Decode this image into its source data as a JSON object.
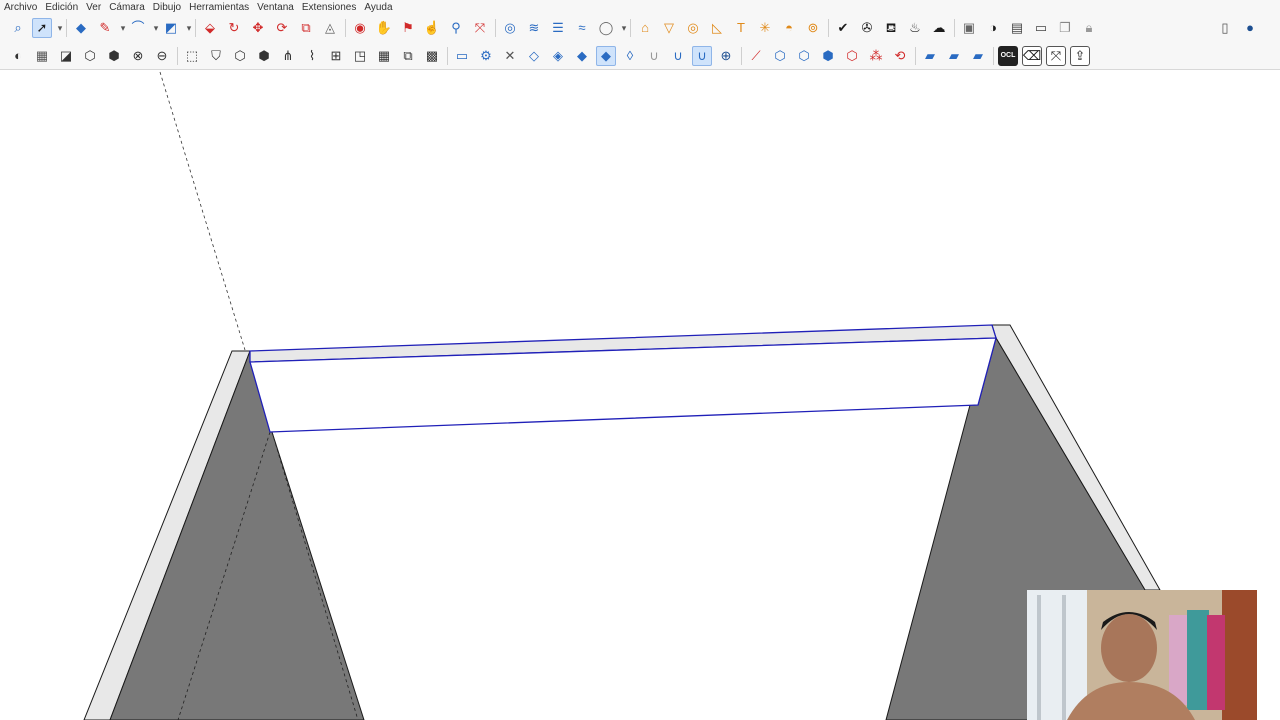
{
  "menu": {
    "items": [
      "Archivo",
      "Edición",
      "Ver",
      "Cámara",
      "Dibujo",
      "Herramientas",
      "Ventana",
      "Extensiones",
      "Ayuda"
    ]
  },
  "toolbar_top": {
    "icons": [
      {
        "name": "search-icon",
        "glyph": "⌕",
        "color": "#2a6bc2"
      },
      {
        "name": "select-tool-icon",
        "glyph": "➚",
        "color": "#1b1b1b",
        "active": true
      },
      {
        "name": "dropdown-arrow-icon",
        "glyph": "▾",
        "color": "#555"
      },
      {
        "name": "eraser-icon",
        "glyph": "◆",
        "color": "#2a6bc2"
      },
      {
        "name": "pencil-icon",
        "glyph": "✎",
        "color": "#d12a2a"
      },
      {
        "name": "dropdown-arrow-icon",
        "glyph": "▾",
        "color": "#555"
      },
      {
        "name": "arc-tool-icon",
        "glyph": "⌒",
        "color": "#2a6bc2"
      },
      {
        "name": "dropdown-arrow-icon",
        "glyph": "▾",
        "color": "#555"
      },
      {
        "name": "rectangle-tool-icon",
        "glyph": "◩",
        "color": "#2a6bc2"
      },
      {
        "name": "dropdown-arrow-icon",
        "glyph": "▾",
        "color": "#555"
      },
      {
        "name": "push-pull-icon",
        "glyph": "⬙",
        "color": "#d12a2a"
      },
      {
        "name": "follow-me-icon",
        "glyph": "↻",
        "color": "#d12a2a"
      },
      {
        "name": "move-tool-icon",
        "glyph": "✥",
        "color": "#d12a2a"
      },
      {
        "name": "rotate-tool-icon",
        "glyph": "⟳",
        "color": "#d12a2a"
      },
      {
        "name": "scale-tool-icon",
        "glyph": "⧉",
        "color": "#d12a2a"
      },
      {
        "name": "offset-tool-icon",
        "glyph": "◬",
        "color": "#666"
      },
      {
        "name": "orbit-icon",
        "glyph": "◉",
        "color": "#d12a2a"
      },
      {
        "name": "pan-icon",
        "glyph": "✋",
        "color": "#2a6bc2"
      },
      {
        "name": "walk-icon",
        "glyph": "⚑",
        "color": "#d12a2a"
      },
      {
        "name": "look-around-icon",
        "glyph": "☝",
        "color": "#d12a2a"
      },
      {
        "name": "zoom-icon",
        "glyph": "⚲",
        "color": "#2a6bc2"
      },
      {
        "name": "zoom-extents-icon",
        "glyph": "⤧",
        "color": "#d12a2a"
      },
      {
        "name": "styles-icon",
        "glyph": "◎",
        "color": "#2a6bc2"
      },
      {
        "name": "sandbox-icon",
        "glyph": "≋",
        "color": "#2a6bc2"
      },
      {
        "name": "layers-icon",
        "glyph": "☰",
        "color": "#2a6bc2"
      },
      {
        "name": "materials-icon",
        "glyph": "≈",
        "color": "#2a6bc2"
      },
      {
        "name": "user-circle-icon",
        "glyph": "◯",
        "color": "#666"
      },
      {
        "name": "dropdown-arrow-icon",
        "glyph": "▾",
        "color": "#555"
      },
      {
        "name": "warehouse-icon",
        "glyph": "⌂",
        "color": "#e08a1a"
      },
      {
        "name": "funnel-icon",
        "glyph": "▽",
        "color": "#e08a1a"
      },
      {
        "name": "ring-icon",
        "glyph": "◎",
        "color": "#e08a1a"
      },
      {
        "name": "protractor-icon",
        "glyph": "◺",
        "color": "#e08a1a"
      },
      {
        "name": "text-tool-icon",
        "glyph": "T",
        "color": "#e08a1a"
      },
      {
        "name": "axes-star-icon",
        "glyph": "✳",
        "color": "#e08a1a"
      },
      {
        "name": "dome-icon",
        "glyph": "◓",
        "color": "#e08a1a"
      },
      {
        "name": "ring-cube-icon",
        "glyph": "⊚",
        "color": "#e08a1a"
      },
      {
        "name": "check-circle-icon",
        "glyph": "✔",
        "color": "#1b1b1b"
      },
      {
        "name": "paint-palette-icon",
        "glyph": "✇",
        "color": "#1b1b1b"
      },
      {
        "name": "teapot-icon",
        "glyph": "⛾",
        "color": "#1b1b1b"
      },
      {
        "name": "teapot-refresh-icon",
        "glyph": "♨",
        "color": "#1b1b1b"
      },
      {
        "name": "cloud-dome-icon",
        "glyph": "☁",
        "color": "#1b1b1b"
      },
      {
        "name": "picture-frame-icon",
        "glyph": "▣",
        "color": "#666"
      },
      {
        "name": "half-circle-icon",
        "glyph": "◑",
        "color": "#1b1b1b"
      },
      {
        "name": "table-icon",
        "glyph": "▤",
        "color": "#444"
      },
      {
        "name": "window-icon",
        "glyph": "▭",
        "color": "#444"
      },
      {
        "name": "stack-window-icon",
        "glyph": "❐",
        "color": "#888"
      },
      {
        "name": "lock-window-icon",
        "glyph": "🔒︎",
        "color": "#999"
      },
      {
        "name": "new-document-icon",
        "glyph": "▯",
        "color": "#555"
      },
      {
        "name": "user-account-icon",
        "glyph": "●",
        "color": "#1d4f91"
      }
    ]
  },
  "toolbar_bottom": {
    "icons": [
      {
        "name": "shadows-icon",
        "glyph": "◐",
        "color": "#333"
      },
      {
        "name": "fog-icon",
        "glyph": "▦",
        "color": "#555"
      },
      {
        "name": "section-plane-icon",
        "glyph": "◪",
        "color": "#333"
      },
      {
        "name": "xray-cube-icon",
        "glyph": "⬡",
        "color": "#333"
      },
      {
        "name": "wire-cube-icon",
        "glyph": "⬢",
        "color": "#333"
      },
      {
        "name": "hatched-sphere-icon",
        "glyph": "⊗",
        "color": "#333"
      },
      {
        "name": "sphere-icon",
        "glyph": "⊖",
        "color": "#333"
      },
      {
        "name": "component-select-icon",
        "glyph": "⬚",
        "color": "#333"
      },
      {
        "name": "camera-position-icon",
        "glyph": "⛉",
        "color": "#333"
      },
      {
        "name": "iso-cube-icon",
        "glyph": "⬡",
        "color": "#333"
      },
      {
        "name": "top-cube-icon",
        "glyph": "⬢",
        "color": "#333"
      },
      {
        "name": "grass-icon",
        "glyph": "⋔",
        "color": "#333"
      },
      {
        "name": "wire-icon",
        "glyph": "⌇",
        "color": "#333"
      },
      {
        "name": "plan-icon",
        "glyph": "⊞",
        "color": "#333"
      },
      {
        "name": "corner-icon",
        "glyph": "◳",
        "color": "#333"
      },
      {
        "name": "grid-icon",
        "glyph": "▦",
        "color": "#333"
      },
      {
        "name": "puzzle-icon",
        "glyph": "⧉",
        "color": "#333"
      },
      {
        "name": "group-icon",
        "glyph": "▩",
        "color": "#333"
      },
      {
        "name": "folder-icon",
        "glyph": "▭",
        "color": "#2a6bc2"
      },
      {
        "name": "gear-icon",
        "glyph": "⚙",
        "color": "#2a6bc2"
      },
      {
        "name": "close-icon",
        "glyph": "✕",
        "color": "#555"
      },
      {
        "name": "drop-outline-icon",
        "glyph": "◇",
        "color": "#2a6bc2"
      },
      {
        "name": "drop-half-icon",
        "glyph": "◈",
        "color": "#2a6bc2"
      },
      {
        "name": "drop-filled-icon",
        "glyph": "◆",
        "color": "#2a6bc2"
      },
      {
        "name": "drop-active-icon",
        "glyph": "◆",
        "color": "#2a6bc2",
        "active": true
      },
      {
        "name": "drop-striped-icon",
        "glyph": "◊",
        "color": "#2a6bc2"
      },
      {
        "name": "magnet-off-icon",
        "glyph": "∪",
        "color": "#999"
      },
      {
        "name": "magnet-icon",
        "glyph": "∪",
        "color": "#2a6bc2"
      },
      {
        "name": "magnet-active-icon",
        "glyph": "∪",
        "color": "#2a6bc2",
        "active": true
      },
      {
        "name": "add-circle-icon",
        "glyph": "⊕",
        "color": "#1d4f91"
      },
      {
        "name": "line-point-icon",
        "glyph": "⟋",
        "color": "#d12a2a"
      },
      {
        "name": "hex-outline-icon",
        "glyph": "⬡",
        "color": "#2a6bc2"
      },
      {
        "name": "hex-inner-icon",
        "glyph": "⬡",
        "color": "#2a6bc2"
      },
      {
        "name": "hex-filled-icon",
        "glyph": "⬢",
        "color": "#2a6bc2"
      },
      {
        "name": "hex-red-icon",
        "glyph": "⬡",
        "color": "#d12a2a"
      },
      {
        "name": "scatter-icon",
        "glyph": "⁂",
        "color": "#d12a2a"
      },
      {
        "name": "cycle-arrows-icon",
        "glyph": "⟲",
        "color": "#d12a2a"
      },
      {
        "name": "tile-plane-icon",
        "glyph": "▰",
        "color": "#2a6bc2"
      },
      {
        "name": "tile-plane-2-icon",
        "glyph": "▰",
        "color": "#2a6bc2"
      },
      {
        "name": "tile-plane-3-icon",
        "glyph": "▰",
        "color": "#2a6bc2"
      },
      {
        "name": "ocl-icon",
        "glyph": "OCL",
        "color": "#ffffff",
        "dark": true
      },
      {
        "name": "eraser-handle-icon",
        "glyph": "⌫",
        "color": "#1b1b1b",
        "framed": true
      },
      {
        "name": "axes-icon",
        "glyph": "⤧",
        "color": "#1b1b1b",
        "framed": true
      },
      {
        "name": "export-icon",
        "glyph": "⇪",
        "color": "#1b1b1b",
        "framed": true
      }
    ]
  },
  "colors": {
    "toolbar_bg": "#f7f7f7",
    "panel_gray": "#7a7a7a",
    "edge_light": "#e8e8e8",
    "selection_blue": "#2020b8",
    "canvas_bg": "#ffffff"
  }
}
